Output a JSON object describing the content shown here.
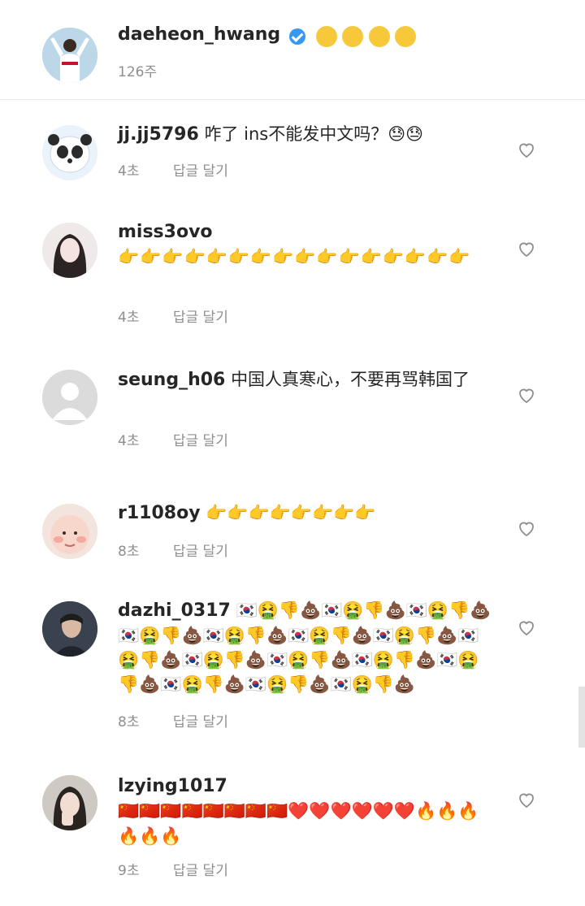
{
  "post": {
    "username": "daeheon_hwang",
    "emoji_text": "😲😶🙄🥴",
    "time": "126주"
  },
  "comments": [
    {
      "username": "jj.jj5796",
      "text": "咋了 ins不能发中文吗？😓😓",
      "time": "4초",
      "reply": "답글 달기"
    },
    {
      "username": "miss3ovo",
      "text": "👉👉👉👉👉👉👉👉👉👉👉👉👉👉👉👉",
      "time": "4초",
      "reply": "답글 달기"
    },
    {
      "username": "seung_h06",
      "text": "中国人真寒心，不要再骂韩国了",
      "time": "4초",
      "reply": "답글 달기"
    },
    {
      "username": "r1108oy",
      "text": "👉👉👉👉👉👉👉👉",
      "time": "8초",
      "reply": "답글 달기"
    },
    {
      "username": "dazhi_0317",
      "text": "🇰🇷🤮👎💩🇰🇷🤮👎💩🇰🇷🤮👎💩🇰🇷🤮👎💩🇰🇷🤮👎💩🇰🇷🤮👎💩🇰🇷🤮👎💩🇰🇷🤮👎💩🇰🇷🤮👎💩🇰🇷🤮👎💩🇰🇷🤮👎💩🇰🇷🤮👎💩🇰🇷🤮👎💩🇰🇷🤮👎💩🇰🇷🤮👎💩",
      "time": "8초",
      "reply": "답글 달기"
    },
    {
      "username": "lzying1017",
      "text": "🇨🇳🇨🇳🇨🇳🇨🇳🇨🇳🇨🇳🇨🇳🇨🇳❤️❤️❤️❤️❤️❤️🔥🔥🔥🔥🔥🔥",
      "time": "9초",
      "reply": "답글 달기"
    }
  ],
  "colors": {
    "accent": "#3897f0",
    "muted": "#8e8e8e",
    "text": "#262626"
  },
  "icons": [
    "verified-badge-icon",
    "heart-icon",
    "avatar-placeholder-icon"
  ]
}
